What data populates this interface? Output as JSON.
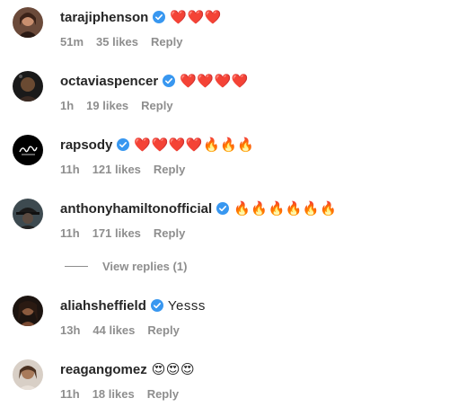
{
  "comments": [
    {
      "username": "tarajiphenson",
      "verified": true,
      "text": "❤️❤️❤️",
      "time": "51m",
      "likes": "35 likes",
      "reply_label": "Reply"
    },
    {
      "username": "octaviaspencer",
      "verified": true,
      "text": "❤️❤️❤️❤️",
      "time": "1h",
      "likes": "19 likes",
      "reply_label": "Reply"
    },
    {
      "username": "rapsody",
      "verified": true,
      "text": "❤️❤️❤️❤️🔥🔥🔥",
      "time": "11h",
      "likes": "121 likes",
      "reply_label": "Reply"
    },
    {
      "username": "anthonyhamiltonofficial",
      "verified": true,
      "text": "🔥🔥🔥🔥🔥🔥",
      "time": "11h",
      "likes": "171 likes",
      "reply_label": "Reply"
    },
    {
      "username": "aliahsheffield",
      "verified": true,
      "text": "Yesss",
      "time": "13h",
      "likes": "44 likes",
      "reply_label": "Reply"
    },
    {
      "username": "reagangomez",
      "verified": false,
      "text": "😍😍😍",
      "time": "11h",
      "likes": "18 likes",
      "reply_label": "Reply"
    }
  ],
  "view_replies_label": "View replies (1)",
  "colors": {
    "verified_badge": "#3897f0",
    "meta_text": "#8e8e8e",
    "username_text": "#262626"
  },
  "icons": {
    "verified": "verified-badge-icon"
  }
}
